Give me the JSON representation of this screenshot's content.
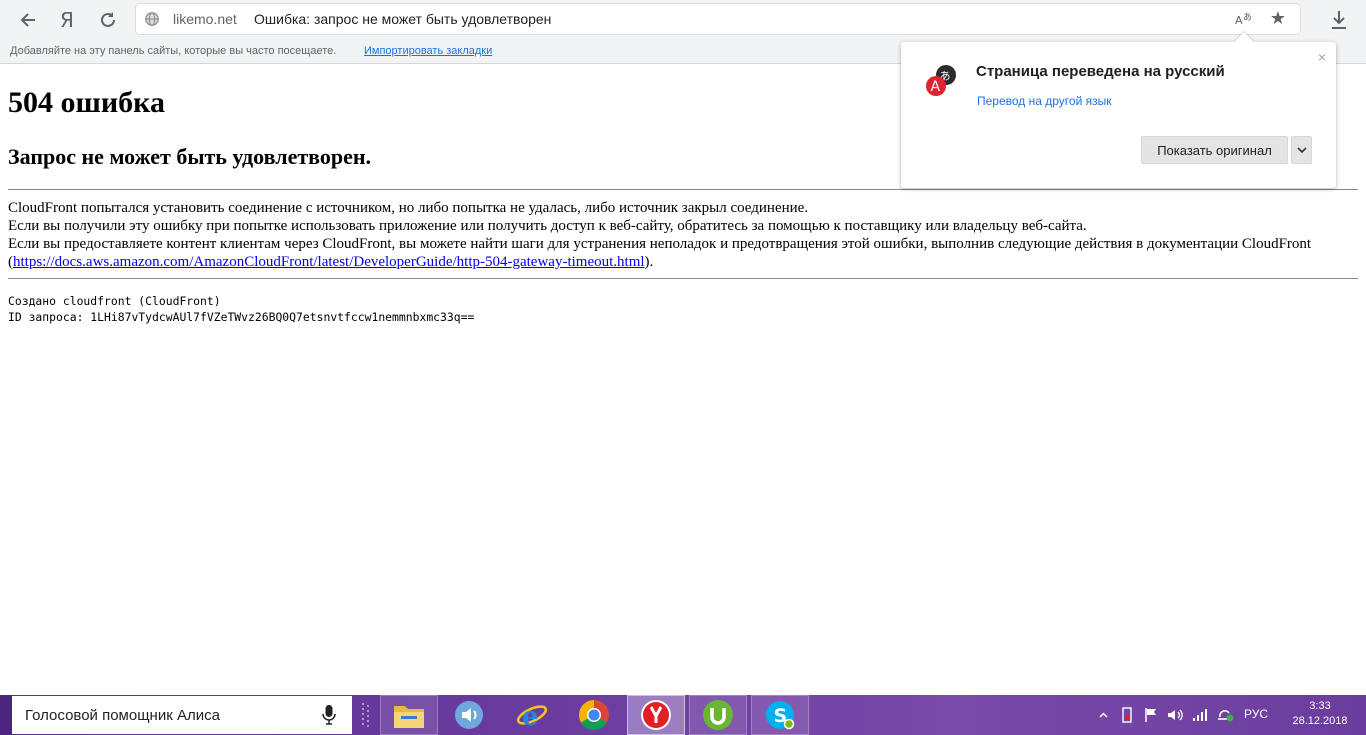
{
  "browser": {
    "domain": "likemo.net",
    "tab_title": "Ошибка: запрос не может быть удовлетворен",
    "ya_label": "Я",
    "bookmarks_bar": {
      "text": "Добавляйте на эту панель сайты, которые вы часто посещаете.",
      "import_link": "Импортировать закладки"
    }
  },
  "page": {
    "heading": "504 ошибка",
    "subheading": "Запрос не может быть удовлетворен.",
    "lines": [
      "CloudFront попытался установить соединение с источником, но либо попытка не удалась, либо источник закрыл соединение.",
      "Если вы получили эту ошибку при попытке использовать приложение или получить доступ к веб-сайту, обратитесь за помощью к поставщику или владельцу веб-сайта.",
      "Если вы предоставляете контент клиентам через CloudFront, вы можете найти шаги для устранения неполадок и предотвращения этой ошибки, выполнив следующие действия в документации CloudFront ("
    ],
    "doc_link": "https://docs.aws.amazon.com/AmazonCloudFront/latest/DeveloperGuide/http-504-gateway-timeout.html",
    "link_suffix": ").",
    "generated_by": "Создано cloudfront (CloudFront)",
    "request_id": "ID запроса: 1LHi87vTydcwAUl7fVZeTWvz26BQ0Q7etsnvtfccw1nemmnbxmc33q=="
  },
  "translate_popup": {
    "title": "Страница переведена на русский",
    "other_language_link": "Перевод на другой язык",
    "show_original_button": "Показать оригинал",
    "close_glyph": "×"
  },
  "taskbar": {
    "alice_placeholder": "Голосовой помощник Алиса",
    "apps": [
      "file-explorer",
      "media-player",
      "internet-explorer",
      "chrome",
      "yandex-browser",
      "utorrent",
      "skype"
    ],
    "language": "РУС",
    "time": "3:33",
    "date": "28.12.2018"
  },
  "colors": {
    "link": "#1a73e8",
    "taskbar": "#6a3ca0",
    "page_link": "#0000ee"
  }
}
